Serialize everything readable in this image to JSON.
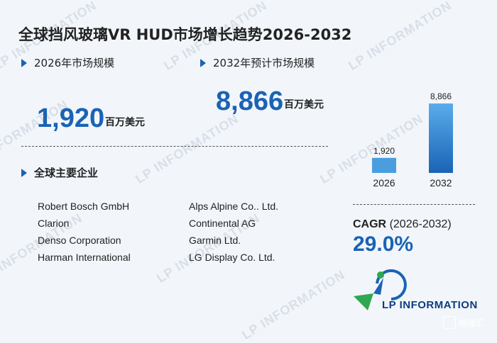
{
  "watermark": "LP INFORMATION",
  "title": "全球挡风玻璃VR HUD市场增长趋势2026-2032",
  "section_2026": {
    "label": "2026年市场规模",
    "value": "1,920",
    "unit": "百万美元"
  },
  "section_2032": {
    "label": "2032年预计市场规模",
    "value": "8,866",
    "unit": "百万美元"
  },
  "companies_heading": "全球主要企业",
  "companies": [
    "Robert Bosch GmbH",
    "Alps Alpine Co.. Ltd.",
    "Clarion",
    "Continental AG",
    "Denso Corporation",
    "Garmin Ltd.",
    "Harman International",
    "LG Display Co. Ltd."
  ],
  "chart_data": {
    "type": "bar",
    "categories": [
      "2026",
      "2032"
    ],
    "values": [
      1920,
      8866
    ],
    "data_labels": [
      "1,920",
      "8,866"
    ],
    "colors": [
      "#4a9ee0",
      "#1a63b5"
    ]
  },
  "cagr": {
    "label": "CAGR",
    "period": "(2026-2032)",
    "value": "29.0%"
  },
  "logo_text": "LP INFORMATION",
  "badge_text": "格隆汇"
}
